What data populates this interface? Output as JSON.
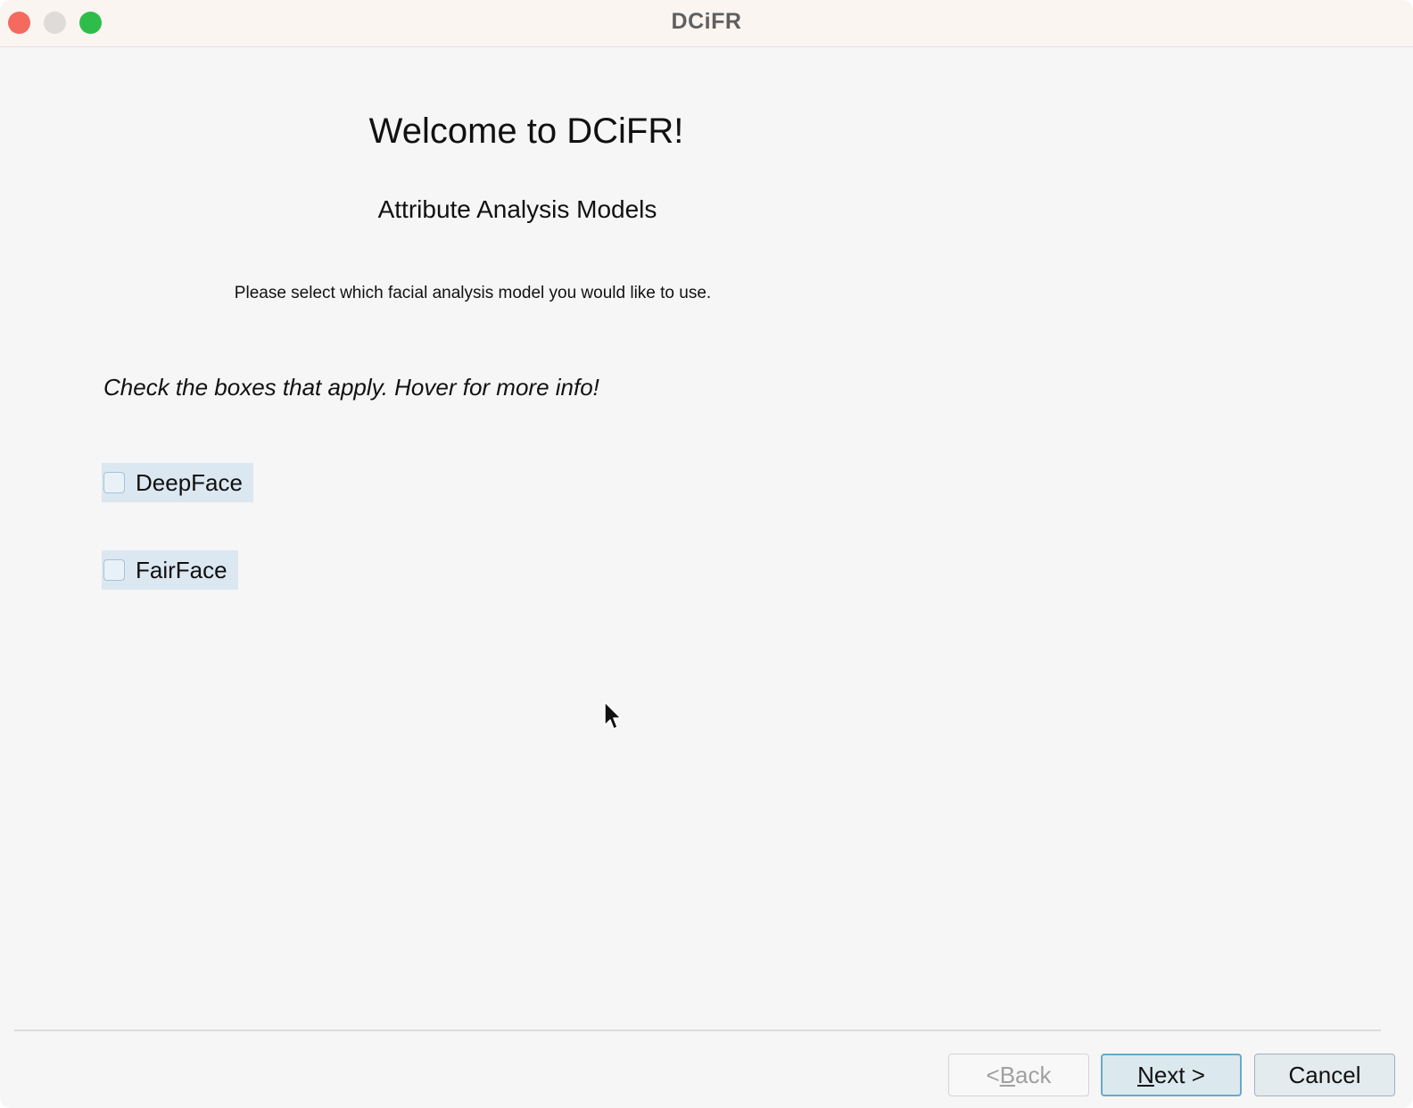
{
  "window": {
    "title": "DCiFR"
  },
  "page": {
    "heading": "Welcome to DCiFR!",
    "subheading": "Attribute Analysis Models",
    "instruction": "Please select which facial analysis model you would like to use.",
    "hint": "Check the boxes that apply. Hover for more info!"
  },
  "models": [
    {
      "label": "DeepFace",
      "checked": false
    },
    {
      "label": "FairFace",
      "checked": false
    }
  ],
  "buttons": {
    "back": {
      "prefix": "< ",
      "mnemonic": "B",
      "rest": "ack",
      "enabled": false
    },
    "next": {
      "mnemonic": "N",
      "rest": "ext >",
      "enabled": true
    },
    "cancel": {
      "label": "Cancel",
      "enabled": true
    }
  },
  "colors": {
    "close": "#f46a5e",
    "minimize": "#dedbd9",
    "zoom": "#2fbd49",
    "checkbox_highlight": "#dbe7f1",
    "default_button_border": "#6aa9c6"
  },
  "icons": {
    "pointer": "mouse-pointer-icon"
  }
}
